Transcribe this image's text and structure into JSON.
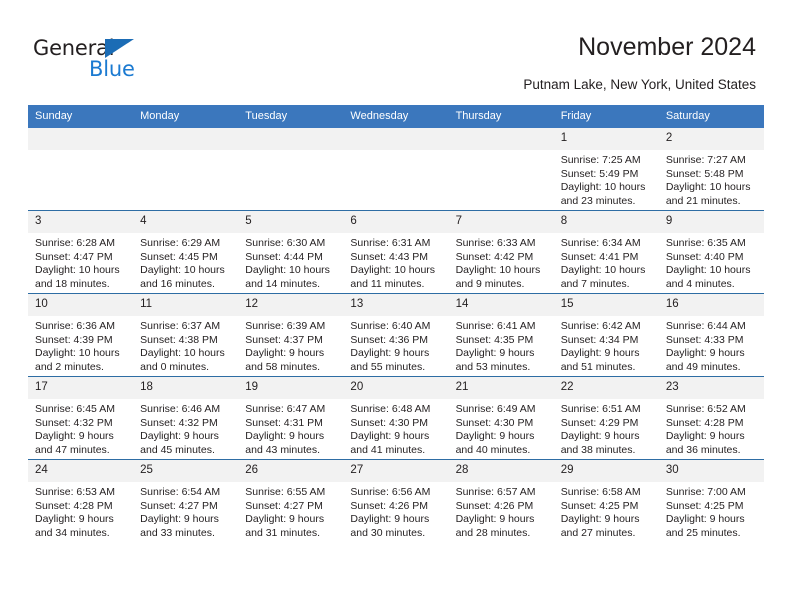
{
  "brand": {
    "word1": "General",
    "word2": "Blue",
    "triangle_color": "#1b6cb5",
    "blue_color": "#1b7ad1"
  },
  "header": {
    "title": "November 2024",
    "location": "Putnam Lake, New York, United States"
  },
  "theme": {
    "header_blue": "#3b77bd",
    "row_divider": "#2e6da4",
    "daynum_band": "#f2f2f2",
    "text": "#231f20"
  },
  "weekday_headers": [
    "Sunday",
    "Monday",
    "Tuesday",
    "Wednesday",
    "Thursday",
    "Friday",
    "Saturday"
  ],
  "labels": {
    "sunrise_prefix": "Sunrise: ",
    "sunset_prefix": "Sunset: ",
    "daylight_prefix": "Daylight: "
  },
  "weeks": [
    [
      {
        "day": "",
        "empty": true
      },
      {
        "day": "",
        "empty": true
      },
      {
        "day": "",
        "empty": true
      },
      {
        "day": "",
        "empty": true
      },
      {
        "day": "",
        "empty": true
      },
      {
        "day": "1",
        "sunrise": "Sunrise: 7:25 AM",
        "sunset": "Sunset: 5:49 PM",
        "daylight": "Daylight: 10 hours and 23 minutes."
      },
      {
        "day": "2",
        "sunrise": "Sunrise: 7:27 AM",
        "sunset": "Sunset: 5:48 PM",
        "daylight": "Daylight: 10 hours and 21 minutes."
      }
    ],
    [
      {
        "day": "3",
        "sunrise": "Sunrise: 6:28 AM",
        "sunset": "Sunset: 4:47 PM",
        "daylight": "Daylight: 10 hours and 18 minutes."
      },
      {
        "day": "4",
        "sunrise": "Sunrise: 6:29 AM",
        "sunset": "Sunset: 4:45 PM",
        "daylight": "Daylight: 10 hours and 16 minutes."
      },
      {
        "day": "5",
        "sunrise": "Sunrise: 6:30 AM",
        "sunset": "Sunset: 4:44 PM",
        "daylight": "Daylight: 10 hours and 14 minutes."
      },
      {
        "day": "6",
        "sunrise": "Sunrise: 6:31 AM",
        "sunset": "Sunset: 4:43 PM",
        "daylight": "Daylight: 10 hours and 11 minutes."
      },
      {
        "day": "7",
        "sunrise": "Sunrise: 6:33 AM",
        "sunset": "Sunset: 4:42 PM",
        "daylight": "Daylight: 10 hours and 9 minutes."
      },
      {
        "day": "8",
        "sunrise": "Sunrise: 6:34 AM",
        "sunset": "Sunset: 4:41 PM",
        "daylight": "Daylight: 10 hours and 7 minutes."
      },
      {
        "day": "9",
        "sunrise": "Sunrise: 6:35 AM",
        "sunset": "Sunset: 4:40 PM",
        "daylight": "Daylight: 10 hours and 4 minutes."
      }
    ],
    [
      {
        "day": "10",
        "sunrise": "Sunrise: 6:36 AM",
        "sunset": "Sunset: 4:39 PM",
        "daylight": "Daylight: 10 hours and 2 minutes."
      },
      {
        "day": "11",
        "sunrise": "Sunrise: 6:37 AM",
        "sunset": "Sunset: 4:38 PM",
        "daylight": "Daylight: 10 hours and 0 minutes."
      },
      {
        "day": "12",
        "sunrise": "Sunrise: 6:39 AM",
        "sunset": "Sunset: 4:37 PM",
        "daylight": "Daylight: 9 hours and 58 minutes."
      },
      {
        "day": "13",
        "sunrise": "Sunrise: 6:40 AM",
        "sunset": "Sunset: 4:36 PM",
        "daylight": "Daylight: 9 hours and 55 minutes."
      },
      {
        "day": "14",
        "sunrise": "Sunrise: 6:41 AM",
        "sunset": "Sunset: 4:35 PM",
        "daylight": "Daylight: 9 hours and 53 minutes."
      },
      {
        "day": "15",
        "sunrise": "Sunrise: 6:42 AM",
        "sunset": "Sunset: 4:34 PM",
        "daylight": "Daylight: 9 hours and 51 minutes."
      },
      {
        "day": "16",
        "sunrise": "Sunrise: 6:44 AM",
        "sunset": "Sunset: 4:33 PM",
        "daylight": "Daylight: 9 hours and 49 minutes."
      }
    ],
    [
      {
        "day": "17",
        "sunrise": "Sunrise: 6:45 AM",
        "sunset": "Sunset: 4:32 PM",
        "daylight": "Daylight: 9 hours and 47 minutes."
      },
      {
        "day": "18",
        "sunrise": "Sunrise: 6:46 AM",
        "sunset": "Sunset: 4:32 PM",
        "daylight": "Daylight: 9 hours and 45 minutes."
      },
      {
        "day": "19",
        "sunrise": "Sunrise: 6:47 AM",
        "sunset": "Sunset: 4:31 PM",
        "daylight": "Daylight: 9 hours and 43 minutes."
      },
      {
        "day": "20",
        "sunrise": "Sunrise: 6:48 AM",
        "sunset": "Sunset: 4:30 PM",
        "daylight": "Daylight: 9 hours and 41 minutes."
      },
      {
        "day": "21",
        "sunrise": "Sunrise: 6:49 AM",
        "sunset": "Sunset: 4:30 PM",
        "daylight": "Daylight: 9 hours and 40 minutes."
      },
      {
        "day": "22",
        "sunrise": "Sunrise: 6:51 AM",
        "sunset": "Sunset: 4:29 PM",
        "daylight": "Daylight: 9 hours and 38 minutes."
      },
      {
        "day": "23",
        "sunrise": "Sunrise: 6:52 AM",
        "sunset": "Sunset: 4:28 PM",
        "daylight": "Daylight: 9 hours and 36 minutes."
      }
    ],
    [
      {
        "day": "24",
        "sunrise": "Sunrise: 6:53 AM",
        "sunset": "Sunset: 4:28 PM",
        "daylight": "Daylight: 9 hours and 34 minutes."
      },
      {
        "day": "25",
        "sunrise": "Sunrise: 6:54 AM",
        "sunset": "Sunset: 4:27 PM",
        "daylight": "Daylight: 9 hours and 33 minutes."
      },
      {
        "day": "26",
        "sunrise": "Sunrise: 6:55 AM",
        "sunset": "Sunset: 4:27 PM",
        "daylight": "Daylight: 9 hours and 31 minutes."
      },
      {
        "day": "27",
        "sunrise": "Sunrise: 6:56 AM",
        "sunset": "Sunset: 4:26 PM",
        "daylight": "Daylight: 9 hours and 30 minutes."
      },
      {
        "day": "28",
        "sunrise": "Sunrise: 6:57 AM",
        "sunset": "Sunset: 4:26 PM",
        "daylight": "Daylight: 9 hours and 28 minutes."
      },
      {
        "day": "29",
        "sunrise": "Sunrise: 6:58 AM",
        "sunset": "Sunset: 4:25 PM",
        "daylight": "Daylight: 9 hours and 27 minutes."
      },
      {
        "day": "30",
        "sunrise": "Sunrise: 7:00 AM",
        "sunset": "Sunset: 4:25 PM",
        "daylight": "Daylight: 9 hours and 25 minutes."
      }
    ]
  ]
}
